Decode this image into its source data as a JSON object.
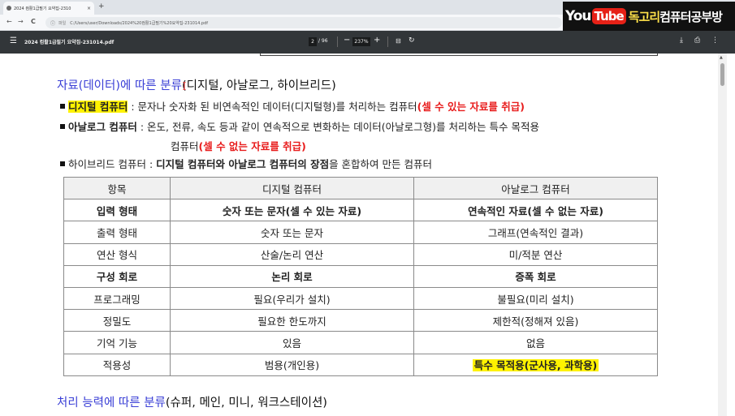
{
  "browser": {
    "tab_title": "2024 컴활1급필기 요약집-2310",
    "tab_close": "×",
    "new_tab": "+",
    "nav_back": "←",
    "nav_forward": "→",
    "nav_reload": "C",
    "address_protocol": "파일",
    "address_url": "C:/Users/user/Downloads/2024%20컴활1급필기%20요약집-231014.pdf"
  },
  "overlay": {
    "you": "You",
    "tube": "Tube",
    "channel_highlight": "독고리",
    "channel_rest": "컴퓨터공부방"
  },
  "pdf_toolbar": {
    "filename": "2024 컴활1급필기 요약집-231014.pdf",
    "page_current": "2",
    "page_total": "/ 96",
    "zoom": "237%",
    "zoom_out": "−",
    "zoom_in": "+"
  },
  "icons": {
    "menu": "menu-icon",
    "fit": "fit-page-icon",
    "rotate": "rotate-icon",
    "download": "download-icon",
    "print": "print-icon",
    "more": "more-icon"
  },
  "doc": {
    "heading_blue": "자료(데이터)에 따른 분류",
    "heading_rest": "(디지털, 아날로그, 하이브리드)",
    "line1": {
      "term": "디지털 컴퓨터",
      "sep": " : ",
      "desc": "문자나 숫자화 된 비연속적인 데이터(디지털형)를 처리하는 컴퓨터",
      "red": "(셀 수 있는 자료를 취급)"
    },
    "line2": {
      "term": "아날로그 컴퓨터",
      "sep": " : ",
      "desc": "온도, 전류, 속도 등과 같이 연속적으로 변화하는 데이터(아날로그형)를 처리하는 특수 목적용"
    },
    "line3": {
      "desc": "컴퓨터",
      "red": "(셀 수 없는 자료를 취급)"
    },
    "line4": {
      "term": "하이브리드 컴퓨터",
      "sep": " : ",
      "bold": "디지털 컴퓨터와 아날로그 컴퓨터의 장점",
      "desc": "을 혼합하여 만든 컴퓨터"
    },
    "table": {
      "headers": [
        "항목",
        "디지털 컴퓨터",
        "아날로그 컴퓨터"
      ],
      "rows": [
        [
          "입력 형태",
          "숫자 또는 문자(셀 수 있는 자료)",
          "연속적인 자료(셀 수 없는 자료)"
        ],
        [
          "출력 형태",
          "숫자 또는 문자",
          "그래프(연속적인 결과)"
        ],
        [
          "연산 형식",
          "산술/논리 연산",
          "미/적분 연산"
        ],
        [
          "구성 회로",
          "논리 회로",
          "증폭 회로"
        ],
        [
          "프로그래밍",
          "필요(우리가 설치)",
          "불필요(미리 설치)"
        ],
        [
          "정밀도",
          "필요한 한도까지",
          "제한적(정해져 있음)"
        ],
        [
          "기억 기능",
          "있음",
          "없음"
        ],
        [
          "적용성",
          "범용(개인용)",
          "특수 목적용(군사용, 과학용)"
        ]
      ]
    },
    "footer_heading_blue": "처리 능력에 따른 분류",
    "footer_heading_rest": "(슈퍼, 메인, 미니, 워크스테이션)"
  }
}
